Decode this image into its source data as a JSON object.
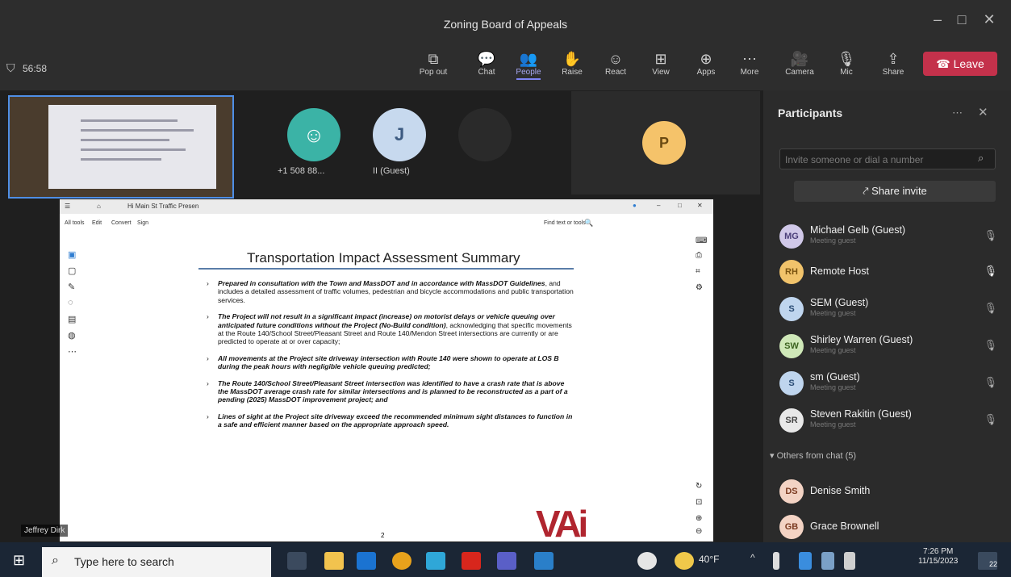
{
  "window": {
    "title": "Zoning Board of Appeals",
    "controls": [
      "–",
      "□",
      "✕"
    ]
  },
  "toolbar": {
    "timer": "56:58",
    "buttons": [
      {
        "label": "Pop out",
        "icon": "popout-icon"
      },
      {
        "label": "Chat",
        "icon": "chat-icon"
      },
      {
        "label": "People",
        "icon": "people-icon",
        "active": true
      },
      {
        "label": "Raise",
        "icon": "raise-hand-icon"
      },
      {
        "label": "React",
        "icon": "react-icon"
      },
      {
        "label": "View",
        "icon": "view-icon"
      },
      {
        "label": "Apps",
        "icon": "apps-icon"
      },
      {
        "label": "More",
        "icon": "more-icon"
      },
      {
        "label": "Camera",
        "icon": "camera-off-icon"
      },
      {
        "label": "Mic",
        "icon": "mic-off-icon"
      },
      {
        "label": "Share",
        "icon": "share-icon"
      }
    ],
    "leave_label": "Leave"
  },
  "stage": {
    "participants": [
      {
        "label": "+1 508 88...",
        "initial": ""
      },
      {
        "label": "II (Guest)",
        "initial": "J"
      },
      {
        "label": "",
        "initial": "P"
      }
    ],
    "presenter": "Jeffrey Dirk"
  },
  "document": {
    "tab_label": "Hi Main St Traffic Presen",
    "menu": [
      "All tools",
      "Edit",
      "Convert",
      "Sign"
    ],
    "find_label": "Find text or tools",
    "title": "Transportation Impact Assessment Summary",
    "bullets": [
      {
        "bold": "Prepared in consultation with the Town and MassDOT and in accordance with MassDOT Guidelines",
        "rest": ", and includes a detailed assessment of traffic volumes, pedestrian and bicycle accommodations and public transportation services."
      },
      {
        "bold": "The Project will not result in a significant impact (increase) on motorist delays or vehicle queuing over anticipated future conditions without the Project (No-Build condition)",
        "rest": ", acknowledging that specific movements at the Route 140/School Street/Pleasant Street and Route 140/Mendon Street intersections are currently or are predicted to operate at or over capacity;"
      },
      {
        "bold": "All movements at the Project site driveway intersection with Route 140 were shown to operate at LOS B during the peak hours with negligible vehicle queuing predicted;",
        "rest": ""
      },
      {
        "bold": "The Route 140/School Street/Pleasant Street intersection was identified to have a crash rate that is above the MassDOT average crash rate for similar intersections and is planned to be reconstructed as a part of a pending (2025) MassDOT improvement project; and",
        "rest": ""
      },
      {
        "bold": "Lines of sight at the Project site driveway exceed the recommended minimum sight distances to function in a safe and efficient manner based on the appropriate approach speed.",
        "rest": ""
      }
    ],
    "page_number": "2",
    "logo": "VAi"
  },
  "panel": {
    "title": "Participants",
    "invite_placeholder": "Invite someone or dial a number",
    "share_invite": "Share invite",
    "people": [
      {
        "initials": "MG",
        "name": "Michael Gelb (Guest)",
        "sub": "Meeting guest",
        "color": "#d0c8e8",
        "fg": "#4b3f7a",
        "muted": true
      },
      {
        "initials": "RH",
        "name": "Remote Host",
        "sub": "",
        "color": "#f1c36b",
        "fg": "#7a5310",
        "muted": false
      },
      {
        "initials": "S",
        "name": "SEM (Guest)",
        "sub": "Meeting guest",
        "color": "#bfd5ee",
        "fg": "#284a73",
        "muted": true
      },
      {
        "initials": "SW",
        "name": "Shirley Warren (Guest)",
        "sub": "Meeting guest",
        "color": "#cfe8b8",
        "fg": "#3c6320",
        "muted": true
      },
      {
        "initials": "S",
        "name": "sm (Guest)",
        "sub": "Meeting guest",
        "color": "#bfd5ee",
        "fg": "#284a73",
        "muted": true
      },
      {
        "initials": "SR",
        "name": "Steven Rakitin (Guest)",
        "sub": "Meeting guest",
        "color": "#e8e8e8",
        "fg": "#444",
        "muted": true
      }
    ],
    "others_label": "Others from chat (5)",
    "others": [
      {
        "initials": "DS",
        "name": "Denise Smith",
        "color": "#f3d3c4",
        "fg": "#7a3a20"
      },
      {
        "initials": "GB",
        "name": "Grace Brownell",
        "color": "#f3d3c4",
        "fg": "#7a3a20"
      }
    ]
  },
  "taskbar": {
    "search_placeholder": "Type here to search",
    "temperature": "40°F",
    "time": "7:26 PM",
    "date": "11/15/2023",
    "notifications": "22"
  }
}
